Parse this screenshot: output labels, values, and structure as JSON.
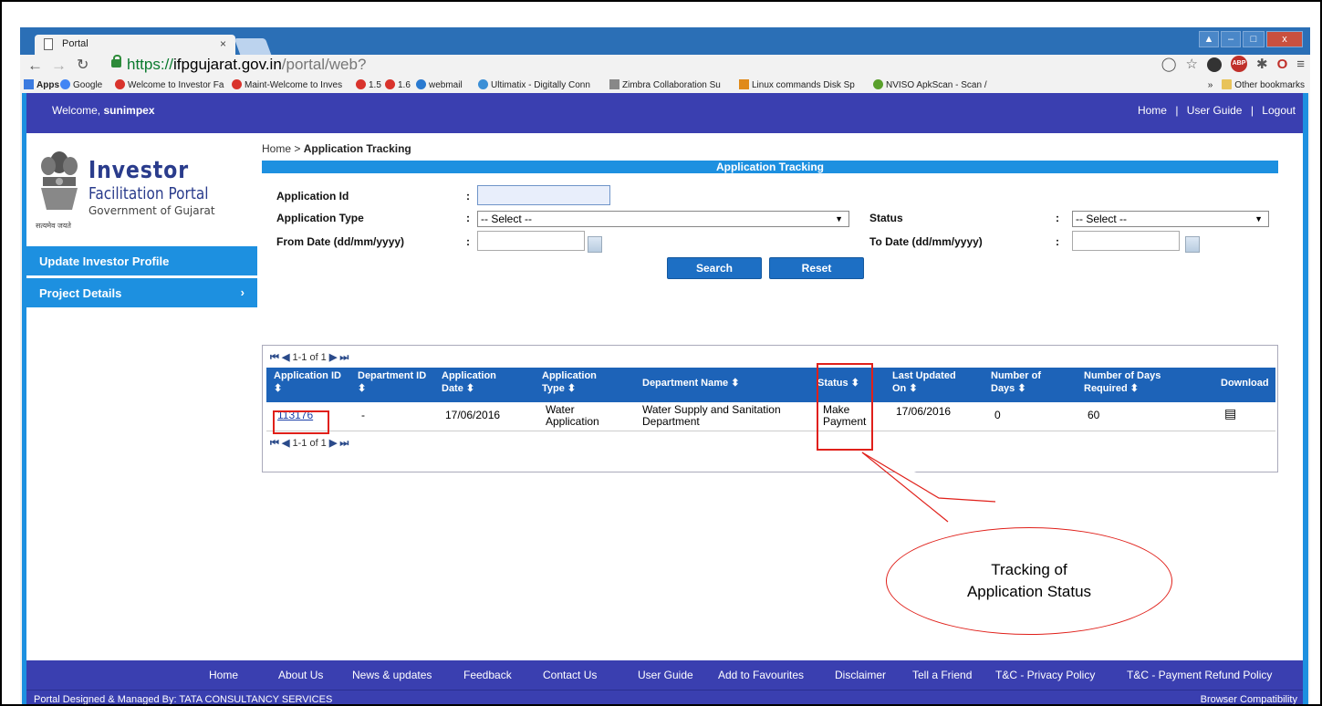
{
  "browser": {
    "tab_title": "Portal",
    "tab_close": "×",
    "url_scheme": "https://",
    "url_host": "ifpgujarat.gov.in",
    "url_path": "/portal/web?",
    "bookmarks": [
      "Apps",
      "Google",
      "Welcome to Investor Fa",
      "Maint-Welcome to Inves",
      "1.5",
      "1.6",
      "webmail",
      "Ultimatix - Digitally Conn",
      "Zimbra Collaboration Su",
      "Linux commands Disk Sp",
      "NVISO ApkScan - Scan /"
    ],
    "overflow": "»",
    "other_bookmarks": "Other bookmarks"
  },
  "header": {
    "welcome_prefix": "Welcome,",
    "username": "sunimpex",
    "links": [
      "Home",
      "User Guide",
      "Logout"
    ],
    "separator": "|"
  },
  "logo": {
    "line1": "Investor",
    "line2": "Facilitation Portal",
    "line3": "Government of Gujarat",
    "motto": "सत्यमेव जयते"
  },
  "sidebar": {
    "items": [
      {
        "label": "Update Investor Profile"
      },
      {
        "label": "Project Details",
        "chevron": "›"
      }
    ]
  },
  "breadcrumb": {
    "home": "Home",
    "sep": ">",
    "current": "Application Tracking"
  },
  "form": {
    "title": "Application Tracking",
    "application_id_label": "Application Id",
    "application_type_label": "Application Type",
    "application_type_value": "-- Select --",
    "status_label": "Status",
    "status_value": "-- Select --",
    "from_date_label": "From Date (dd/mm/yyyy)",
    "to_date_label": "To Date (dd/mm/yyyy)",
    "colon": ":",
    "search_button": "Search",
    "reset_button": "Reset"
  },
  "grid": {
    "pager_text": "1-1 of 1",
    "columns": [
      "Application ID",
      "Department ID",
      "Application Date",
      "Application Type",
      "Department Name",
      "Status",
      "Last Updated On",
      "Number of Days",
      "Number of Days Required",
      "Download"
    ],
    "sort_glyph": "⬍",
    "row": {
      "application_id": "113176",
      "department_id": "-",
      "application_date": "17/06/2016",
      "application_type": "Water Application",
      "department_name": "Water Supply and Sanitation Department",
      "status": "Make Payment",
      "last_updated_on": "17/06/2016",
      "number_of_days": "0",
      "days_required": "60"
    }
  },
  "annotation": {
    "line1": "Tracking of",
    "line2": "Application Status",
    "color": "#e0201a"
  },
  "footer": {
    "links": [
      "Home",
      "About Us",
      "News & updates",
      "Feedback",
      "Contact Us",
      "User Guide",
      "Add to Favourites",
      "Disclaimer",
      "Tell a Friend",
      "T&C - Privacy Policy",
      "T&C - Payment Refund Policy"
    ],
    "credit": "Portal Designed & Managed By: TATA CONSULTANCY SERVICES",
    "browser_compat": "Browser Compatibility"
  },
  "colors": {
    "header_bg": "#3a3fb0",
    "accent_blue": "#1d90e0",
    "grid_header": "#1d63b8"
  }
}
